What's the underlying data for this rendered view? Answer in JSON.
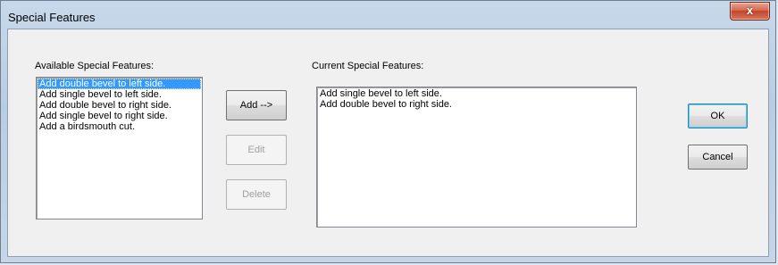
{
  "window": {
    "title": "Special Features",
    "close_glyph": "x"
  },
  "available": {
    "label": "Available Special Features:",
    "items": [
      "Add double bevel to left side.",
      "Add single bevel to left side.",
      "Add double bevel to right side.",
      "Add single bevel to right side.",
      "Add a birdsmouth cut."
    ],
    "selected_index": 0
  },
  "current": {
    "label": "Current Special Features:",
    "items": [
      "Add single bevel to left side.",
      "Add double bevel to right side."
    ]
  },
  "buttons": {
    "add": "Add -->",
    "edit": "Edit",
    "delete": "Delete",
    "ok": "OK",
    "cancel": "Cancel"
  },
  "colors": {
    "selection": "#3399ff",
    "close_button": "#c4452a"
  }
}
